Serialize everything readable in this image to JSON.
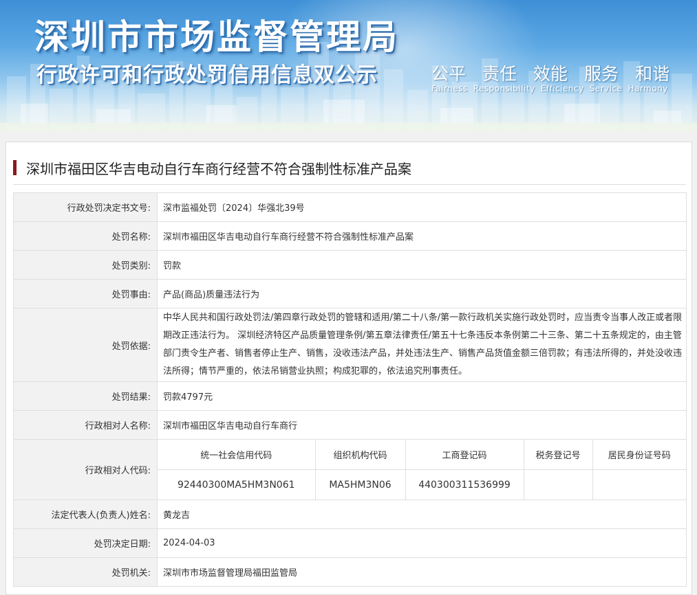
{
  "banner": {
    "title": "深圳市市场监督管理局",
    "subtitle": "行政许可和行政处罚信用信息双公示",
    "slogans_cn": [
      "公平",
      "责任",
      "效能",
      "服务",
      "和谐"
    ],
    "slogans_en": [
      "Fairness",
      "Responsibility",
      "Efficiency",
      "Service",
      "Harmony"
    ]
  },
  "case": {
    "title": "深圳市福田区华吉电动自行车商行经营不符合强制性标准产品案",
    "accent_color": "#8b1a1a"
  },
  "fields": {
    "decision_no": {
      "label": "行政处罚决定书文号:",
      "value": "深市监福处罚〔2024〕华强北39号"
    },
    "penalty_name": {
      "label": "处罚名称:",
      "value": "深圳市福田区华吉电动自行车商行经营不符合强制性标准产品案"
    },
    "penalty_type": {
      "label": "处罚类别:",
      "value": "罚款"
    },
    "penalty_reason": {
      "label": "处罚事由:",
      "value": "产品(商品)质量违法行为"
    },
    "penalty_basis": {
      "label": "处罚依据:",
      "value": "中华人民共和国行政处罚法/第四章行政处罚的管辖和适用/第二十八条/第一款行政机关实施行政处罚时，应当责令当事人改正或者限期改正违法行为。 深圳经济特区产品质量管理条例/第五章法律责任/第五十七条违反本条例第二十三条、第二十五条规定的，由主管部门责令生产者、销售者停止生产、销售，没收违法产品，并处违法生产、销售产品货值金额三倍罚款；有违法所得的，并处没收违法所得；情节严重的，依法吊销营业执照；构成犯罪的，依法追究刑事责任。"
    },
    "penalty_result": {
      "label": "处罚结果:",
      "value": "罚款4797元"
    },
    "counterpart_name": {
      "label": "行政相对人名称:",
      "value": "深圳市福田区华吉电动自行车商行"
    },
    "counterpart_code": {
      "label": "行政相对人代码:",
      "headers": [
        "统一社会信用代码",
        "组织机构代码",
        "工商登记码",
        "税务登记号",
        "居民身份证号码"
      ],
      "values": [
        "92440300MA5HM3N061",
        "MA5HM3N06",
        "440300311536999",
        "",
        ""
      ]
    },
    "legal_rep": {
      "label": "法定代表人(负责人)姓名:",
      "value": "黄龙吉"
    },
    "decision_date": {
      "label": "处罚决定日期:",
      "value": "2024-04-03"
    },
    "authority": {
      "label": "处罚机关:",
      "value": "深圳市市场监督管理局福田监管局"
    }
  }
}
